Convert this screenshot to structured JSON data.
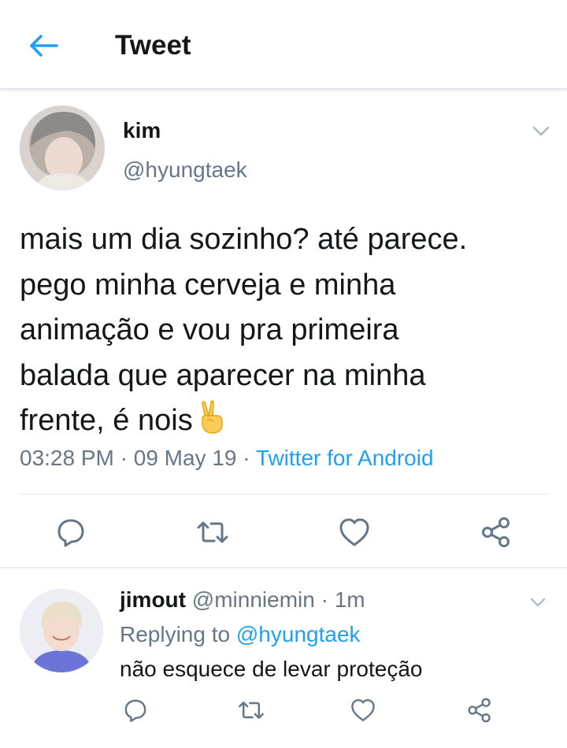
{
  "colors": {
    "accent": "#1da1f2",
    "text": "#14171a",
    "muted": "#657786",
    "divider": "#e1e8ed"
  },
  "header": {
    "title": "Tweet",
    "back_icon": "arrow-left-icon"
  },
  "tweet": {
    "author_name": "kim",
    "author_handle": "@hyungtaek",
    "lines": [
      "mais um dia sozinho? até parece.",
      "pego minha cerveja e minha",
      "animação e vou pra primeira",
      "balada que aparecer na minha",
      "frente, é nois"
    ],
    "emoji": "victory-hand-icon",
    "time": "03:28 PM",
    "sep": "·",
    "date": "09 May 19",
    "source": "Twitter for Android",
    "actions": [
      "reply-icon",
      "retweet-icon",
      "like-icon",
      "share-icon"
    ]
  },
  "reply": {
    "author_name": "jimout",
    "author_handle": "@minniemin",
    "sep": "·",
    "time": "1m",
    "replying_label": "Replying to",
    "replying_to": "@hyungtaek",
    "text": "não esquece de levar proteção"
  }
}
